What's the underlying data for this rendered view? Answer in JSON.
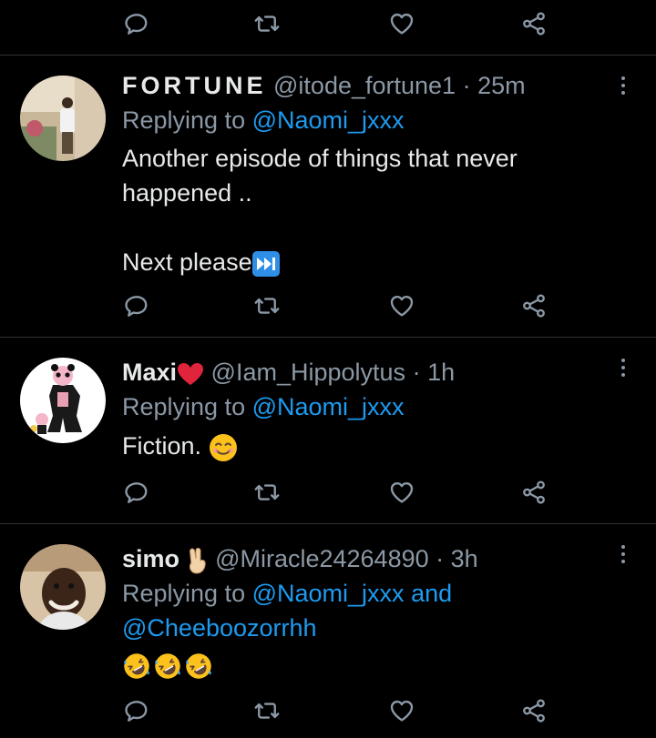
{
  "colors": {
    "background": "#000000",
    "text": "#e7e9ea",
    "muted": "#8b98a5",
    "link": "#1d9bf0",
    "divider": "#2f3336",
    "heart_emoji": "#e0243b"
  },
  "action_icons": [
    "reply-icon",
    "retweet-icon",
    "like-icon",
    "share-icon"
  ],
  "tweets": [
    {
      "author": "FORTUNE",
      "handle": "@itode_fortune1",
      "separator": "·",
      "time": "25m",
      "replying_prefix": "Replying to",
      "mentions": [
        "@Naomi_jxxx"
      ],
      "text_lines": [
        "Another episode of things that never",
        "happened ..",
        "",
        "Next please"
      ],
      "trailing_emoji": "next-track-button-emoji"
    },
    {
      "author": "Maxi",
      "author_emoji": "red-heart-emoji",
      "handle": "@Iam_Hippolytus",
      "separator": "·",
      "time": "1h",
      "replying_prefix": "Replying to",
      "mentions": [
        "@Naomi_jxxx"
      ],
      "text": "Fiction.",
      "trailing_emoji": "smiling-face-emoji"
    },
    {
      "author": "simo",
      "author_emoji": "victory-hand-emoji",
      "handle": "@Miracle24264890",
      "separator": "·",
      "time": "3h",
      "replying_prefix": "Replying to",
      "mentions": [
        "@Naomi_jxxx",
        "@Cheeboozorrhh"
      ],
      "mention_joiner": "and",
      "emojis": [
        "rolling-on-floor-laughing-emoji",
        "rolling-on-floor-laughing-emoji",
        "rolling-on-floor-laughing-emoji"
      ]
    }
  ]
}
